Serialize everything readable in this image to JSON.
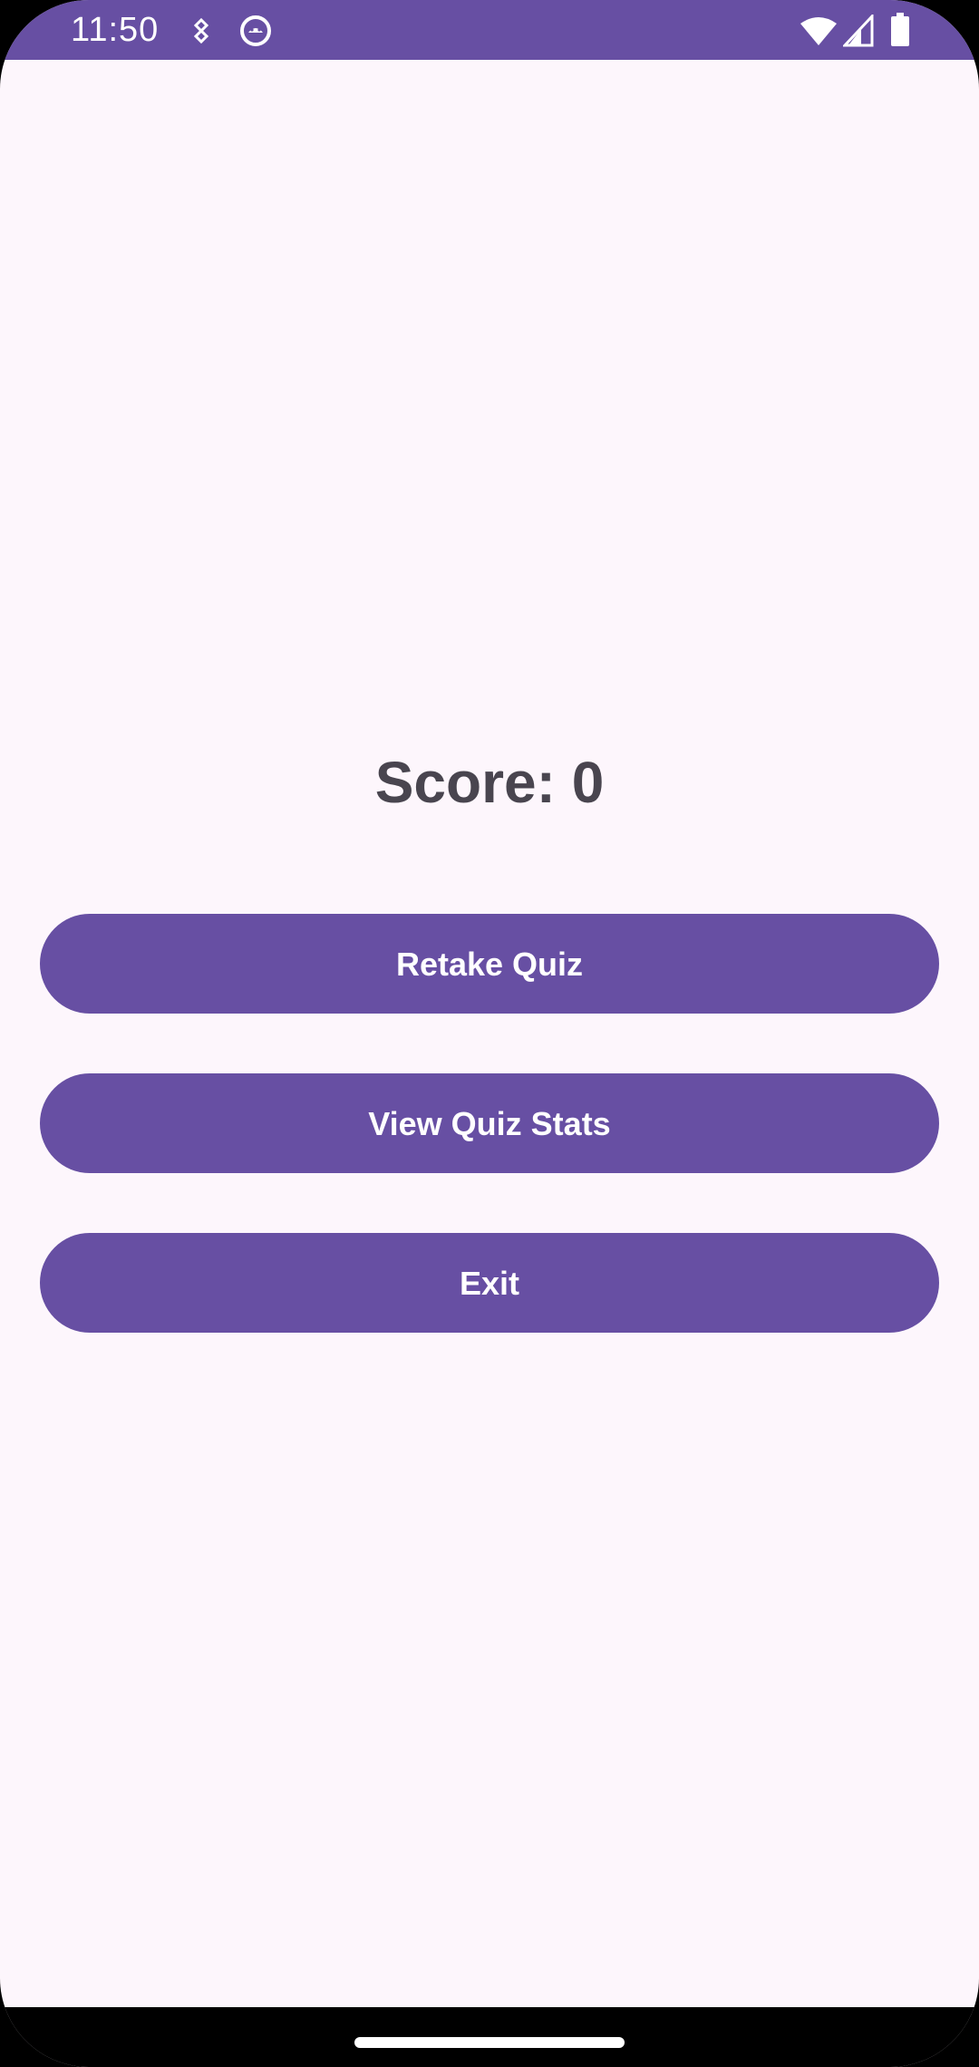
{
  "status_bar": {
    "time": "11:50",
    "left_icons": [
      "location-pin-icon",
      "android-debug-icon"
    ],
    "right_icons": [
      "wifi-icon",
      "cell-signal-icon",
      "battery-icon"
    ],
    "color": "#674FA3"
  },
  "main": {
    "score_text": "Score: 0",
    "buttons": {
      "retake": "Retake Quiz",
      "stats": "View Quiz Stats",
      "exit": "Exit"
    }
  },
  "theme": {
    "accent": "#674FA3",
    "background": "#FDF6FC",
    "text": "#49454F"
  }
}
